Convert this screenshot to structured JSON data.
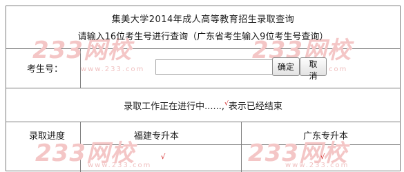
{
  "header": {
    "title": "集美大学2014年成人高等教育招生录取查询",
    "instructions": "请输入16位考生号进行查询（广东省考生输入9位考生号查询）"
  },
  "form": {
    "exam_number_label": "考生号：",
    "exam_number_value": "",
    "confirm_label": "确定",
    "cancel_label": "取消"
  },
  "status": {
    "text": "录取工作正在进行中......,",
    "check_mark": "√",
    "suffix": "表示已经结束"
  },
  "progress": {
    "row_label": "录取进度",
    "columns": [
      {
        "label": "福建专升本",
        "check": "√"
      },
      {
        "label": "广东专升本",
        "check": "√"
      }
    ]
  },
  "watermark": {
    "big_text": "233网校",
    "small_text": "www.233.com"
  },
  "colors": {
    "border": "#7a7a7a",
    "check_mark": "#d11a1a",
    "watermark": "#f4c6c6"
  }
}
